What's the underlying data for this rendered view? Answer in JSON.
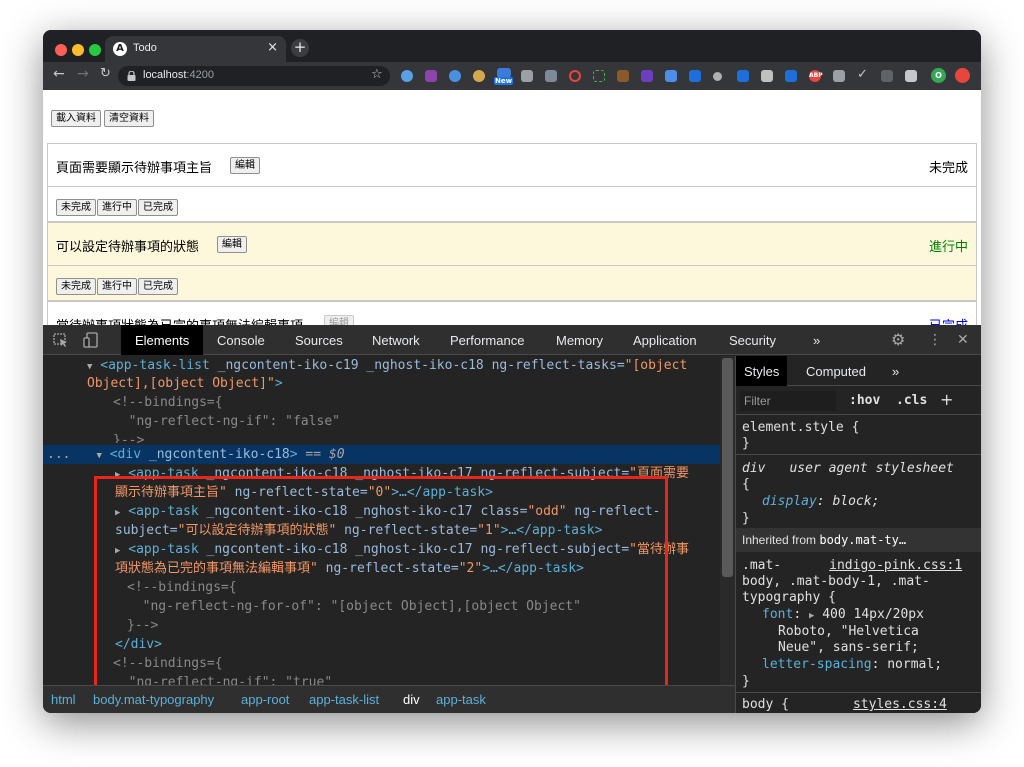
{
  "browser": {
    "tab_title": "Todo",
    "tab_favicon": "A",
    "tab_close": "×",
    "new_tab": "+",
    "url_host": "localhost",
    "url_port": ":4200",
    "ext_new_badge": "New",
    "ext_abp_label": "ABP",
    "profile_initial": "O"
  },
  "page": {
    "load_button": "載入資料",
    "clear_button": "清空資料",
    "tasks": [
      {
        "subject": "頁面需要顯示待辦事項主旨",
        "edit_label": "編輯",
        "state": "未完成",
        "state_color": "#000000",
        "bg": "#ffffff",
        "buttons": [
          "未完成",
          "進行中",
          "已完成"
        ]
      },
      {
        "subject": "可以設定待辦事項的狀態",
        "edit_label": "編輯",
        "state": "進行中",
        "state_color": "#008000",
        "bg": "#fdf8dc",
        "buttons": [
          "未完成",
          "進行中",
          "已完成"
        ]
      },
      {
        "subject": "當待辦事項狀態為已完的事項無法編輯事項",
        "edit_label": "編輯",
        "state": "已完成",
        "state_color": "#0000ee",
        "bg": "#ffffff"
      }
    ]
  },
  "devtools": {
    "tabs": [
      "Elements",
      "Console",
      "Sources",
      "Network",
      "Performance",
      "Memory",
      "Application",
      "Security",
      "»"
    ],
    "active_tab": "Elements",
    "dom_lines": {
      "l1_tag": "<app-task-list",
      "l1_attrs": " _ngcontent-iko-c19 _nghost-iko-c18 ng-reflect-tasks=",
      "l1_val": "\"[object",
      "l2_val": "Object],[object Object]\"",
      "l2_end": ">",
      "l3": "<!--bindings={",
      "l4": "  \"ng-reflect-ng-if\": \"false\"",
      "l5": "}-->",
      "sel_dots": "...",
      "sel_tag": "<div",
      "sel_attr": " _ngcontent-iko-c18",
      "sel_end": ">",
      "sel_eq": " == ",
      "sel_var": "$0",
      "t1_tag": "<app-task",
      "t1_attrs": " _ngcontent-iko-c18 _nghost-iko-c17 ng-reflect-subject=",
      "t1_val": "\"頁面需要",
      "t1b_val": "顯示待辦事項主旨\"",
      "t1b_attr": " ng-reflect-state=",
      "t1b_state": "\"0\"",
      "t1b_end": ">…</app-task>",
      "t2_tag": "<app-task",
      "t2_attrs": " _ngcontent-iko-c18 _nghost-iko-c17 class=",
      "t2_class": "\"odd\"",
      "t2_attr2": " ng-reflect-",
      "t2b_attr": "subject=",
      "t2b_val": "\"可以設定待辦事項的狀態\"",
      "t2b_attr2": " ng-reflect-state=",
      "t2b_state": "\"1\"",
      "t2b_end": ">…</app-task>",
      "t3_tag": "<app-task",
      "t3_attrs": " _ngcontent-iko-c18 _nghost-iko-c17 ng-reflect-subject=",
      "t3_val": "\"當待辦事",
      "t3b_val": "項狀態為已完的事項無法編輯事項\"",
      "t3b_attr": " ng-reflect-state=",
      "t3b_state": "\"2\"",
      "t3b_end": ">…</app-task>",
      "c1": "<!--bindings={",
      "c2": "  \"ng-reflect-ng-for-of\": \"[object Object],[object Object\"",
      "c3": "}-->",
      "div_close": "</div>",
      "c4": "<!--bindings={",
      "c5": "  \"ng-reflect-ng-if\": \"true\""
    },
    "breadcrumbs": [
      "html",
      "body.mat-typography",
      "app-root",
      "app-task-list",
      "div",
      "app-task"
    ],
    "styles": {
      "tabs": [
        "Styles",
        "Computed",
        "»"
      ],
      "filter_placeholder": "Filter",
      "hov": ":hov",
      "cls": ".cls",
      "plus": "+",
      "element_style": "element.style {",
      "close": "}",
      "ua_selector": "div",
      "ua_label": "user agent stylesheet",
      "open": "{",
      "display_prop": "display",
      "display_val": "block;",
      "inherited_label": "Inherited from",
      "inherited_from": "body.mat-ty…",
      "rule_sel1": ".mat-",
      "rule_source": "indigo-pink.css:1",
      "rule_sel2": "body, .mat-body-1, .mat-",
      "rule_sel3": "typography {",
      "font_prop": "font",
      "font_val1": "400 14px/20px",
      "font_val2": "Roboto, \"Helvetica",
      "font_val3": "Neue\", sans-serif;",
      "ls_prop": "letter-spacing",
      "ls_val": "normal;",
      "next_sel": "body {",
      "next_src": "styles.css:4"
    }
  }
}
